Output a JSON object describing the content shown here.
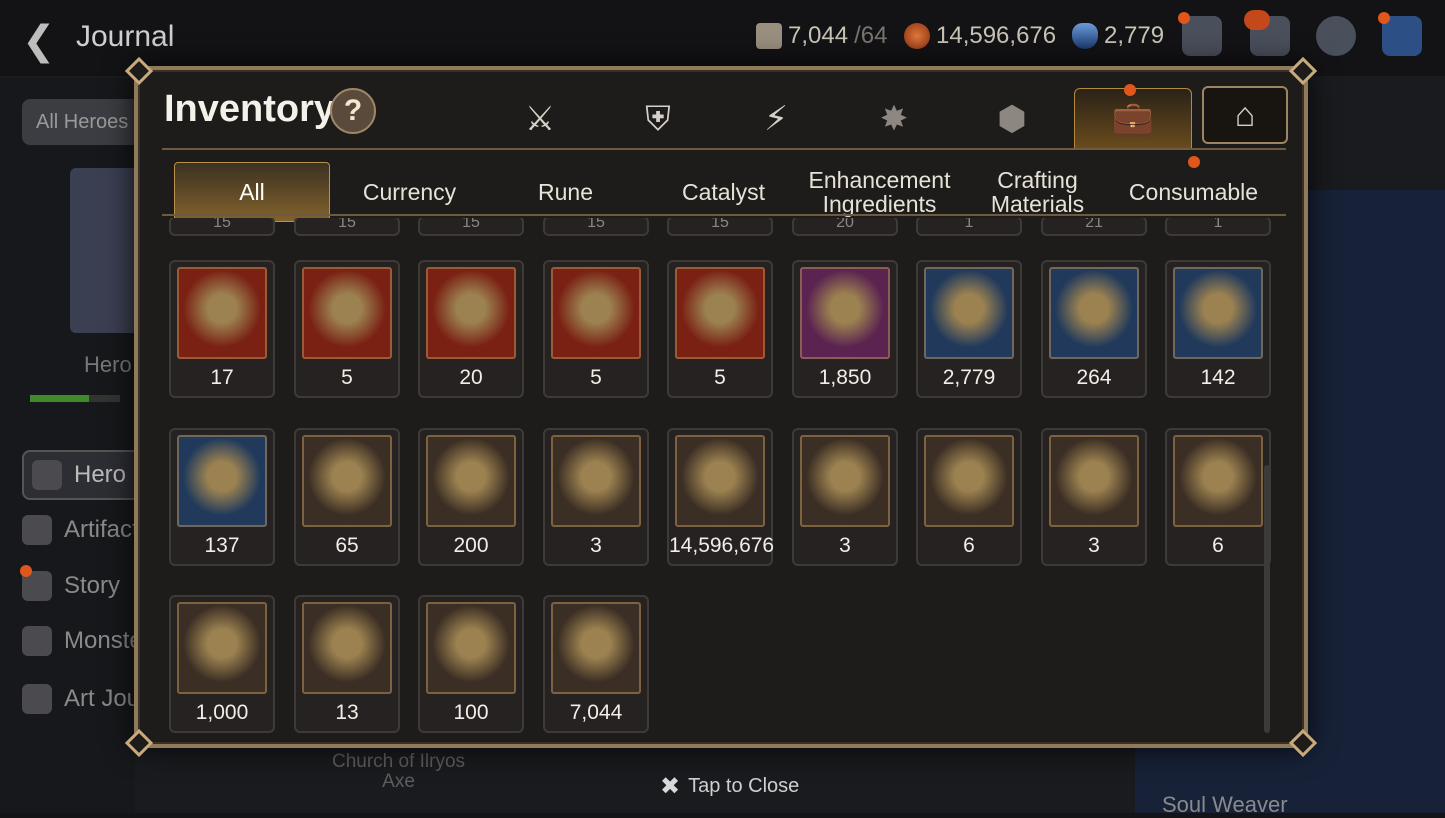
{
  "header": {
    "back_label": "<",
    "title": "Journal",
    "resources": [
      {
        "icon": "skystone-icon",
        "value": "7,044",
        "suffix": "/64",
        "color": "#9a8f7f"
      },
      {
        "icon": "gold-coin-icon",
        "value": "14,596,676",
        "color": "#c4572a"
      },
      {
        "icon": "crystal-icon",
        "value": "2,779",
        "color": "#3f6fb0"
      }
    ]
  },
  "background": {
    "filter_button": "All Heroes",
    "hero_label": "Hero",
    "menu": [
      "Hero",
      "Artifact",
      "Story",
      "Monster",
      "Art Journal"
    ],
    "church_line1": "Church of Ilryos",
    "church_line2": "Axe",
    "soul_weaver": "Soul Weaver"
  },
  "inventory": {
    "title": "Inventory",
    "help_label": "?",
    "category_tabs": [
      "equipment-icon",
      "artifact-icon",
      "skill-bolt-icon",
      "spirit-icon",
      "cube-icon",
      "bag-icon",
      "house-icon"
    ],
    "subtabs": [
      "All",
      "Currency",
      "Rune",
      "Catalyst",
      "Enhancement\nIngredients",
      "Crafting\nMaterials",
      "Consumable"
    ],
    "active_subtab": "All",
    "partial_row_qty": [
      "15",
      "15",
      "15",
      "15",
      "15",
      "20",
      "1",
      "21",
      "1"
    ],
    "items": [
      {
        "qty": "17",
        "icon": "rune-fragment-icon",
        "bg": "#7a2114"
      },
      {
        "qty": "5",
        "icon": "fire-rune-icon",
        "bg": "#7a2114"
      },
      {
        "qty": "20",
        "icon": "gear-rune-icon",
        "bg": "#7a2114"
      },
      {
        "qty": "5",
        "icon": "tree-rune-icon",
        "bg": "#7a2114"
      },
      {
        "qty": "5",
        "icon": "water-rune-icon",
        "bg": "#7a2114"
      },
      {
        "qty": "1,850",
        "icon": "flower-rune-icon",
        "bg": "#5b2450"
      },
      {
        "qty": "2,779",
        "icon": "blue-crystal-icon",
        "bg": "#213a5c"
      },
      {
        "qty": "264",
        "icon": "star-rune-icon",
        "bg": "#213a5c"
      },
      {
        "qty": "142",
        "icon": "leaf-icon",
        "bg": "#213a5c"
      },
      {
        "qty": "137",
        "icon": "mountain-gem-icon",
        "bg": "#213a5c"
      },
      {
        "qty": "65",
        "icon": "green-heart-icon",
        "bg": "#3b2e24"
      },
      {
        "qty": "200",
        "icon": "gold-emblem-icon",
        "bg": "#3b2e24"
      },
      {
        "qty": "3",
        "icon": "pet-pouch-icon",
        "bg": "#3b2e24"
      },
      {
        "qty": "14,596,676",
        "icon": "gold-coin-icon",
        "bg": "#3b2e24"
      },
      {
        "qty": "3",
        "icon": "stone-compass-icon",
        "bg": "#3b2e24"
      },
      {
        "qty": "6",
        "icon": "banner-icon",
        "bg": "#3b2e24"
      },
      {
        "qty": "3",
        "icon": "stamp-icon",
        "bg": "#3b2e24"
      },
      {
        "qty": "6",
        "icon": "lava-orb-icon",
        "bg": "#3b2e24"
      },
      {
        "qty": "1,000",
        "icon": "fist-badge-icon",
        "bg": "#3b2e24"
      },
      {
        "qty": "13",
        "icon": "red-leaf-icon",
        "bg": "#3b2e24"
      },
      {
        "qty": "100",
        "icon": "bracelet-icon",
        "bg": "#3b2e24"
      },
      {
        "qty": "7,044",
        "icon": "chess-knight-icon",
        "bg": "#3b2e24"
      }
    ]
  },
  "footer": {
    "close_label": "Tap to Close"
  }
}
